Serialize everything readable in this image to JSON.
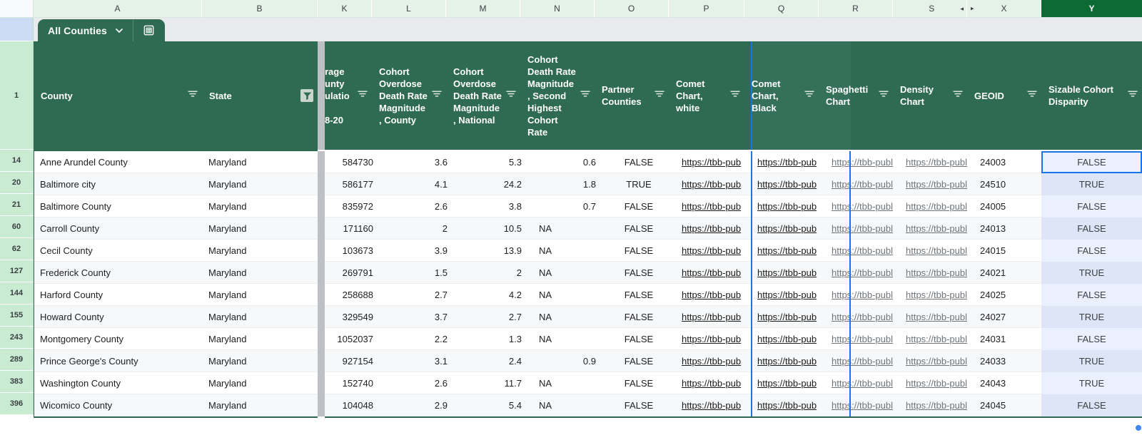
{
  "sheet": {
    "tab_label": "All Counties",
    "tab_chevron_icon": "chevron-down-icon",
    "tab_grid_icon": "spreadsheet-grid-icon",
    "accent_green": "#2f6b52",
    "selected_column_green": "#0b6b33",
    "selection_blue": "#1a73e8",
    "row_header_green": "#c9ebd2"
  },
  "column_letters": [
    "A",
    "B",
    "K",
    "L",
    "M",
    "N",
    "O",
    "P",
    "Q",
    "R",
    "S",
    "X",
    "Y"
  ],
  "collapsed_marker": {
    "left_arrow": "◂",
    "right_arrow": "▸"
  },
  "selected_column_letter": "Y",
  "header_row_number": "1",
  "headers": [
    {
      "key": "county",
      "label": "County",
      "filter": "inactive"
    },
    {
      "key": "state",
      "label": "State",
      "filter": "active"
    },
    {
      "key": "population",
      "label": "rage\nunty\nulatio\n\n8-20",
      "filter": "inactive"
    },
    {
      "key": "cohort_county",
      "label": "Cohort Overdose Death Rate Magnitude, County",
      "filter": "inactive"
    },
    {
      "key": "cohort_nat",
      "label": "Cohort Overdose Death Rate Magnitude, National",
      "filter": "inactive"
    },
    {
      "key": "cohort_2nd",
      "label": "Cohort Death Rate Magnitude, Second Highest Cohort Rate",
      "filter": "inactive"
    },
    {
      "key": "partner",
      "label": "Partner Counties",
      "filter": "inactive"
    },
    {
      "key": "comet_white",
      "label": "Comet Chart, white",
      "filter": "inactive"
    },
    {
      "key": "comet_black",
      "label": "Comet Chart, Black",
      "filter": "inactive"
    },
    {
      "key": "spaghetti",
      "label": "Spaghetti Chart",
      "filter": "inactive"
    },
    {
      "key": "density",
      "label": "Density Chart",
      "filter": "inactive"
    },
    {
      "key": "geoid",
      "label": "GEOID",
      "filter": "inactive"
    },
    {
      "key": "sizable",
      "label": "Sizable Cohort Disparity",
      "filter": "inactive"
    }
  ],
  "rows": [
    {
      "n": "14",
      "county": "Anne Arundel County",
      "state": "Maryland",
      "population": "584730",
      "cohort_county": "3.6",
      "cohort_nat": "5.3",
      "cohort_2nd": "0.6",
      "partner": "FALSE",
      "comet_white": "https://tbb-pub",
      "comet_black": "https://tbb-pub",
      "spaghetti": "https://tbb-publ",
      "density": "https://tbb-publ",
      "geoid": "24003",
      "sizable": "FALSE"
    },
    {
      "n": "20",
      "county": "Baltimore city",
      "state": "Maryland",
      "population": "586177",
      "cohort_county": "4.1",
      "cohort_nat": "24.2",
      "cohort_2nd": "1.8",
      "partner": "TRUE",
      "comet_white": "https://tbb-pub",
      "comet_black": "https://tbb-pub",
      "spaghetti": "https://tbb-publ",
      "density": "https://tbb-publ",
      "geoid": "24510",
      "sizable": "TRUE"
    },
    {
      "n": "21",
      "county": "Baltimore County",
      "state": "Maryland",
      "population": "835972",
      "cohort_county": "2.6",
      "cohort_nat": "3.8",
      "cohort_2nd": "0.7",
      "partner": "FALSE",
      "comet_white": "https://tbb-pub",
      "comet_black": "https://tbb-pub",
      "spaghetti": "https://tbb-publ",
      "density": "https://tbb-publ",
      "geoid": "24005",
      "sizable": "FALSE"
    },
    {
      "n": "60",
      "county": "Carroll County",
      "state": "Maryland",
      "population": "171160",
      "cohort_county": "2",
      "cohort_nat": "10.5",
      "cohort_2nd": "NA",
      "partner": "FALSE",
      "comet_white": "https://tbb-pub",
      "comet_black": "https://tbb-pub",
      "spaghetti": "https://tbb-publ",
      "density": "https://tbb-publ",
      "geoid": "24013",
      "sizable": "FALSE"
    },
    {
      "n": "62",
      "county": "Cecil County",
      "state": "Maryland",
      "population": "103673",
      "cohort_county": "3.9",
      "cohort_nat": "13.9",
      "cohort_2nd": "NA",
      "partner": "FALSE",
      "comet_white": "https://tbb-pub",
      "comet_black": "https://tbb-pub",
      "spaghetti": "https://tbb-publ",
      "density": "https://tbb-publ",
      "geoid": "24015",
      "sizable": "FALSE"
    },
    {
      "n": "127",
      "county": "Frederick County",
      "state": "Maryland",
      "population": "269791",
      "cohort_county": "1.5",
      "cohort_nat": "2",
      "cohort_2nd": "NA",
      "partner": "FALSE",
      "comet_white": "https://tbb-pub",
      "comet_black": "https://tbb-pub",
      "spaghetti": "https://tbb-publ",
      "density": "https://tbb-publ",
      "geoid": "24021",
      "sizable": "TRUE"
    },
    {
      "n": "144",
      "county": "Harford County",
      "state": "Maryland",
      "population": "258688",
      "cohort_county": "2.7",
      "cohort_nat": "4.2",
      "cohort_2nd": "NA",
      "partner": "FALSE",
      "comet_white": "https://tbb-pub",
      "comet_black": "https://tbb-pub",
      "spaghetti": "https://tbb-publ",
      "density": "https://tbb-publ",
      "geoid": "24025",
      "sizable": "FALSE"
    },
    {
      "n": "155",
      "county": "Howard County",
      "state": "Maryland",
      "population": "329549",
      "cohort_county": "3.7",
      "cohort_nat": "2.7",
      "cohort_2nd": "NA",
      "partner": "FALSE",
      "comet_white": "https://tbb-pub",
      "comet_black": "https://tbb-pub",
      "spaghetti": "https://tbb-publ",
      "density": "https://tbb-publ",
      "geoid": "24027",
      "sizable": "TRUE"
    },
    {
      "n": "243",
      "county": "Montgomery County",
      "state": "Maryland",
      "population": "1052037",
      "cohort_county": "2.2",
      "cohort_nat": "1.3",
      "cohort_2nd": "NA",
      "partner": "FALSE",
      "comet_white": "https://tbb-pub",
      "comet_black": "https://tbb-pub",
      "spaghetti": "https://tbb-publ",
      "density": "https://tbb-publ",
      "geoid": "24031",
      "sizable": "FALSE"
    },
    {
      "n": "289",
      "county": "Prince George's County",
      "state": "Maryland",
      "population": "927154",
      "cohort_county": "3.1",
      "cohort_nat": "2.4",
      "cohort_2nd": "0.9",
      "partner": "FALSE",
      "comet_white": "https://tbb-pub",
      "comet_black": "https://tbb-pub",
      "spaghetti": "https://tbb-publ",
      "density": "https://tbb-publ",
      "geoid": "24033",
      "sizable": "TRUE"
    },
    {
      "n": "383",
      "county": "Washington County",
      "state": "Maryland",
      "population": "152740",
      "cohort_county": "2.6",
      "cohort_nat": "11.7",
      "cohort_2nd": "NA",
      "partner": "FALSE",
      "comet_white": "https://tbb-pub",
      "comet_black": "https://tbb-pub",
      "spaghetti": "https://tbb-publ",
      "density": "https://tbb-publ",
      "geoid": "24043",
      "sizable": "TRUE"
    },
    {
      "n": "396",
      "county": "Wicomico County",
      "state": "Maryland",
      "population": "104048",
      "cohort_county": "2.9",
      "cohort_nat": "5.4",
      "cohort_2nd": "NA",
      "partner": "FALSE",
      "comet_white": "https://tbb-pub",
      "comet_black": "https://tbb-pub",
      "spaghetti": "https://tbb-publ",
      "density": "https://tbb-publ",
      "geoid": "24045",
      "sizable": "FALSE"
    }
  ]
}
